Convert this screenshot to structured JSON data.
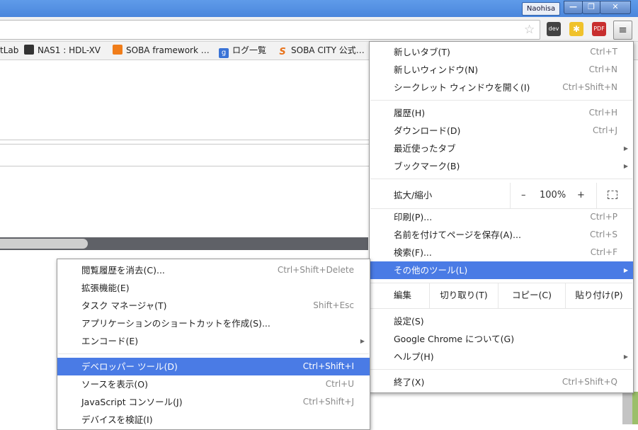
{
  "window": {
    "profile_name": "Naohisa",
    "min": "—",
    "max": "❐",
    "close": "✕"
  },
  "toolbar": {
    "star_icon": "☆",
    "menu_icon": "≡",
    "extensions": [
      "dev",
      "✱",
      "PDF"
    ]
  },
  "bookmarks": [
    {
      "label": "tLab"
    },
    {
      "label": "NAS1 : HDL-XV"
    },
    {
      "label": "SOBA framework …"
    },
    {
      "label": "ログ一覧",
      "icon": "g"
    },
    {
      "label": "SOBA CITY 公式…",
      "icon": "S"
    }
  ],
  "main_menu": {
    "items": [
      {
        "label": "新しいタブ(T)",
        "shortcut": "Ctrl+T"
      },
      {
        "label": "新しいウィンドウ(N)",
        "shortcut": "Ctrl+N"
      },
      {
        "label": "シークレット ウィンドウを開く(I)",
        "shortcut": "Ctrl+Shift+N"
      },
      {
        "label": "履歴(H)",
        "shortcut": "Ctrl+H"
      },
      {
        "label": "ダウンロード(D)",
        "shortcut": "Ctrl+J"
      },
      {
        "label": "最近使ったタブ",
        "arrow": "▶"
      },
      {
        "label": "ブックマーク(B)",
        "arrow": "▶"
      },
      {
        "label": "印刷(P)...",
        "shortcut": "Ctrl+P"
      },
      {
        "label": "名前を付けてページを保存(A)...",
        "shortcut": "Ctrl+S"
      },
      {
        "label": "検索(F)...",
        "shortcut": "Ctrl+F"
      },
      {
        "label": "その他のツール(L)",
        "arrow": "▶"
      },
      {
        "label": "設定(S)"
      },
      {
        "label": "Google Chrome について(G)"
      },
      {
        "label": "ヘルプ(H)",
        "arrow": "▶"
      },
      {
        "label": "終了(X)",
        "shortcut": "Ctrl+Shift+Q"
      }
    ],
    "zoom": {
      "label": "拡大/縮小",
      "minus": "–",
      "value": "100%",
      "plus": "+"
    },
    "edit": {
      "label": "編集",
      "cut": "切り取り(T)",
      "copy": "コピー(C)",
      "paste": "貼り付け(P)"
    }
  },
  "sub_menu": {
    "items": [
      {
        "label": "閲覧履歴を消去(C)...",
        "shortcut": "Ctrl+Shift+Delete"
      },
      {
        "label": "拡張機能(E)"
      },
      {
        "label": "タスク マネージャ(T)",
        "shortcut": "Shift+Esc"
      },
      {
        "label": "アプリケーションのショートカットを作成(S)..."
      },
      {
        "label": "エンコード(E)",
        "arrow": "▶"
      },
      {
        "label": "デベロッパー ツール(D)",
        "shortcut": "Ctrl+Shift+I"
      },
      {
        "label": "ソースを表示(O)",
        "shortcut": "Ctrl+U"
      },
      {
        "label": "JavaScript コンソール(J)",
        "shortcut": "Ctrl+Shift+J"
      },
      {
        "label": "デバイスを検証(I)"
      }
    ]
  },
  "colors": {
    "highlight": "#4a7be5",
    "titlebar": "#4a86dc"
  }
}
